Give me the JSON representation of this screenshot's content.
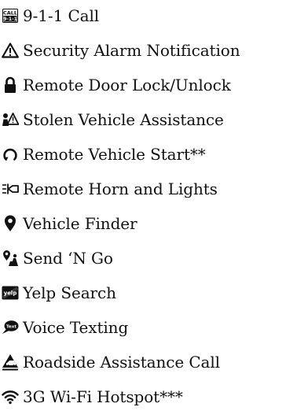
{
  "features": [
    {
      "icon": "call-911-icon",
      "label": "9-1-1 Call"
    },
    {
      "icon": "warning-triangle-icon",
      "label": "Security Alarm Notification"
    },
    {
      "icon": "padlock-icon",
      "label": "Remote Door Lock/Unlock"
    },
    {
      "icon": "stolen-vehicle-icon",
      "label": "Stolen Vehicle Assistance"
    },
    {
      "icon": "remote-start-icon",
      "label": "Remote Vehicle Start**"
    },
    {
      "icon": "horn-lights-icon",
      "label": "Remote Horn and Lights"
    },
    {
      "icon": "map-pin-icon",
      "label": "Vehicle Finder"
    },
    {
      "icon": "send-n-go-icon",
      "label": "Send ‘N Go"
    },
    {
      "icon": "yelp-icon",
      "label": "Yelp Search"
    },
    {
      "icon": "text-bubble-icon",
      "label": "Voice Texting"
    },
    {
      "icon": "roadside-assistance-icon",
      "label": "Roadside Assistance Call"
    },
    {
      "icon": "wifi-icon",
      "label": "3G Wi-Fi Hotspot***"
    }
  ],
  "icon_glyph_text": {
    "call_top": "CALL",
    "call_bottom": "9-1-1",
    "yelp": "yelp",
    "text": "Text"
  }
}
